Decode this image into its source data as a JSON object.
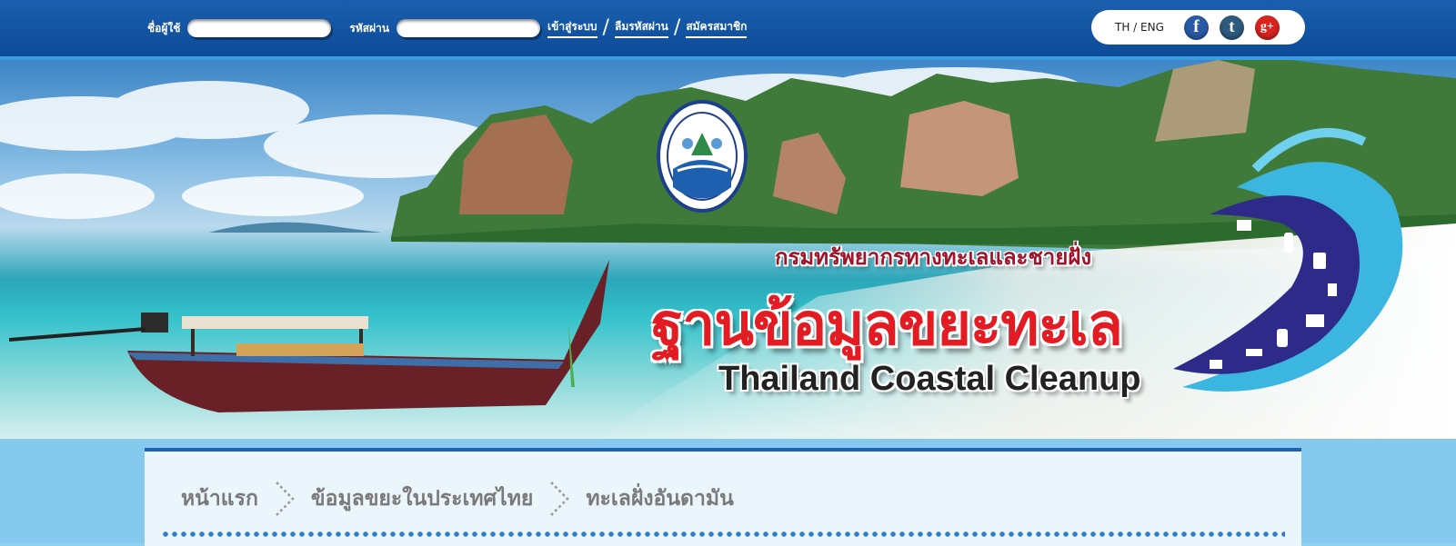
{
  "login": {
    "username_label": "ชื่อผู้ใช้",
    "password_label": "รหัสผ่าน",
    "username_value": "",
    "password_value": "",
    "login_link": "เข้าสู่ระบบ",
    "forgot_link": "ลืมรหัสผ่าน",
    "register_link": "สมัครสมาชิก"
  },
  "header_right": {
    "language": "TH / ENG",
    "social": [
      {
        "name": "facebook",
        "glyph": "f",
        "color": "#2a5aa6"
      },
      {
        "name": "tumblr",
        "glyph": "t",
        "color": "#2e5a7e"
      },
      {
        "name": "google-plus",
        "glyph": "g+",
        "color": "#d8231f"
      }
    ]
  },
  "banner": {
    "department": "กรมทรัพยากรทางทะเลและชายฝั่ง",
    "title_th": "ฐานข้อมูลขยะทะเล",
    "title_en": "Thailand Coastal Cleanup"
  },
  "breadcrumb": {
    "items": [
      "หน้าแรก",
      "ข้อมูลขยะในประเทศไทย",
      "ทะเลฝั่งอันดามัน"
    ]
  },
  "colors": {
    "topbar": "#0d4b98",
    "title_red": "#e31b23",
    "dept_red": "#a0132a",
    "breadcrumb_text": "#7a7a7a",
    "content_border": "#1a63b2"
  }
}
